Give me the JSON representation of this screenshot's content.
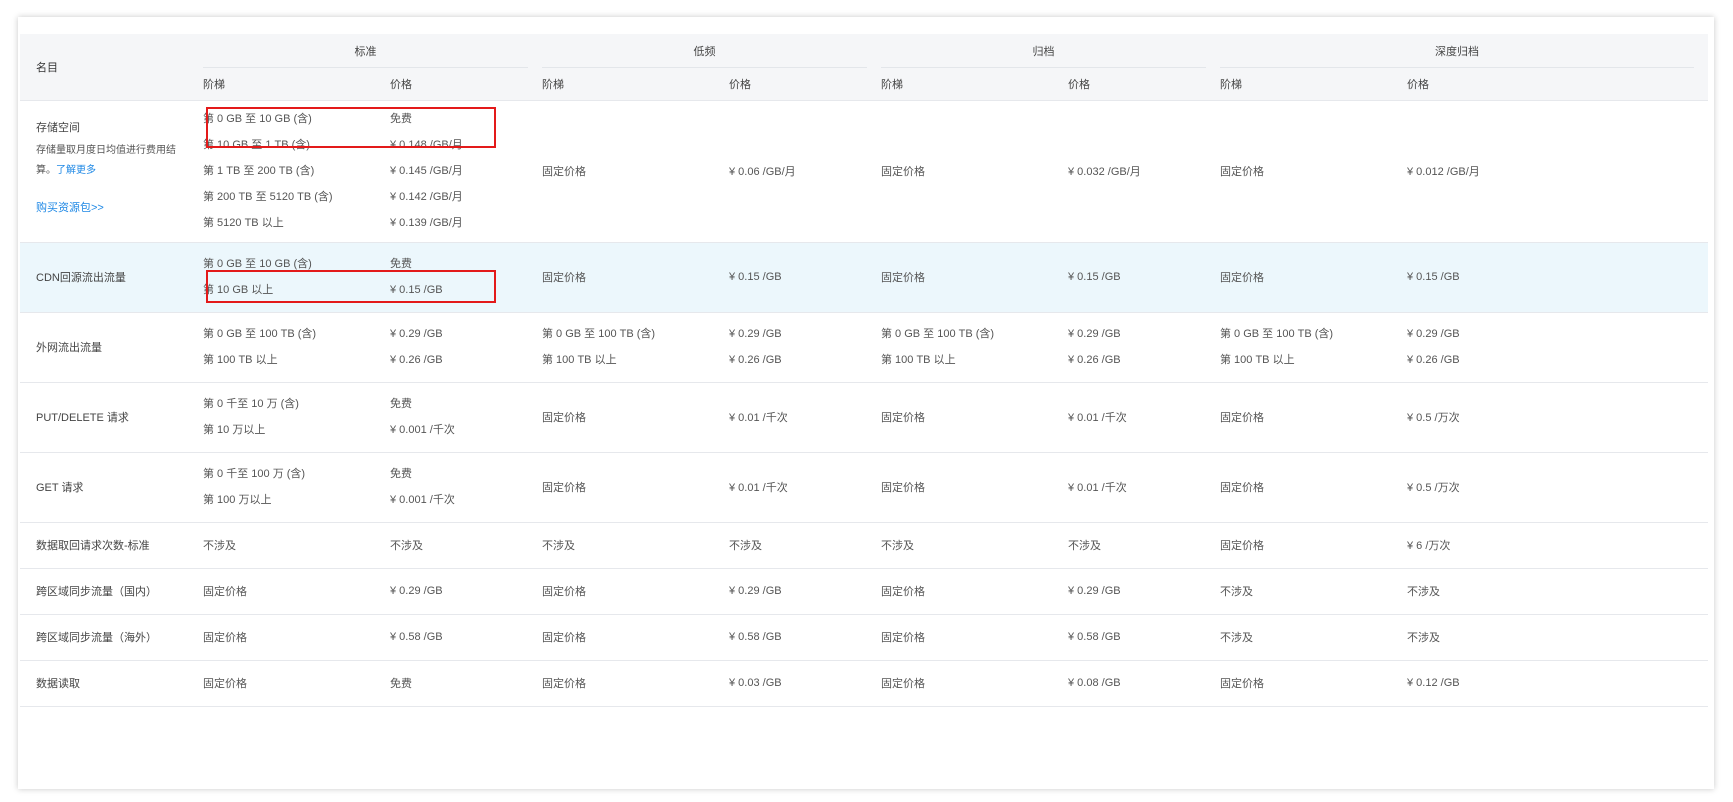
{
  "header": {
    "name_label": "名目",
    "groups": [
      "标准",
      "低频",
      "归档",
      "深度归档"
    ],
    "tier_label": "阶梯",
    "price_label": "价格"
  },
  "rows": {
    "storage": {
      "name": "存储空间",
      "note": "存储量取月度日均值进行费用结算。",
      "note_link": "了解更多",
      "buy_link": "购买资源包>>",
      "std_tiers": [
        "第 0 GB 至 10 GB (含)",
        "第 10 GB 至 1 TB (含)",
        "第 1 TB 至 200 TB (含)",
        "第 200 TB 至 5120 TB (含)",
        "第 5120 TB 以上"
      ],
      "std_prices": [
        "免费",
        "¥ 0.148 /GB/月",
        "¥ 0.145 /GB/月",
        "¥ 0.142 /GB/月",
        "¥ 0.139 /GB/月"
      ],
      "low_tier": "固定价格",
      "low_price": "¥ 0.06 /GB/月",
      "arc_tier": "固定价格",
      "arc_price": "¥ 0.032 /GB/月",
      "deep_tier": "固定价格",
      "deep_price": "¥ 0.012 /GB/月"
    },
    "cdn": {
      "name": "CDN回源流出流量",
      "std_tiers": [
        "第 0 GB 至 10 GB (含)",
        "第 10 GB 以上"
      ],
      "std_prices": [
        "免费",
        "¥ 0.15 /GB"
      ],
      "low_tier": "固定价格",
      "low_price": "¥ 0.15 /GB",
      "arc_tier": "固定价格",
      "arc_price": "¥ 0.15 /GB",
      "deep_tier": "固定价格",
      "deep_price": "¥ 0.15 /GB"
    },
    "internet": {
      "name": "外网流出流量",
      "tiers": [
        "第 0 GB 至 100 TB (含)",
        "第 100 TB 以上"
      ],
      "prices": [
        "¥ 0.29 /GB",
        "¥ 0.26 /GB"
      ]
    },
    "put": {
      "name": "PUT/DELETE 请求",
      "std_tiers": [
        "第 0 千至 10 万 (含)",
        "第 10 万以上"
      ],
      "std_prices": [
        "免费",
        "¥ 0.001 /千次"
      ],
      "low_tier": "固定价格",
      "low_price": "¥ 0.01 /千次",
      "arc_tier": "固定价格",
      "arc_price": "¥ 0.01 /千次",
      "deep_tier": "固定价格",
      "deep_price": "¥ 0.5 /万次"
    },
    "get": {
      "name": "GET 请求",
      "std_tiers": [
        "第 0 千至 100 万 (含)",
        "第 100 万以上"
      ],
      "std_prices": [
        "免费",
        "¥ 0.001 /千次"
      ],
      "low_tier": "固定价格",
      "low_price": "¥ 0.01 /千次",
      "arc_tier": "固定价格",
      "arc_price": "¥ 0.01 /千次",
      "deep_tier": "固定价格",
      "deep_price": "¥ 0.5 /万次"
    },
    "retrieval": {
      "name": "数据取回请求次数-标准",
      "cells": [
        "不涉及",
        "不涉及",
        "不涉及",
        "不涉及",
        "不涉及",
        "不涉及",
        "固定价格",
        "¥ 6 /万次"
      ]
    },
    "crd": {
      "name": "跨区域同步流量（国内）",
      "cells": [
        "固定价格",
        "¥ 0.29 /GB",
        "固定价格",
        "¥ 0.29 /GB",
        "固定价格",
        "¥ 0.29 /GB",
        "不涉及",
        "不涉及"
      ]
    },
    "cro": {
      "name": "跨区域同步流量（海外）",
      "cells": [
        "固定价格",
        "¥ 0.58 /GB",
        "固定价格",
        "¥ 0.58 /GB",
        "固定价格",
        "¥ 0.58 /GB",
        "不涉及",
        "不涉及"
      ]
    },
    "read": {
      "name": "数据读取",
      "cells": [
        "固定价格",
        "免费",
        "固定价格",
        "¥ 0.03 /GB",
        "固定价格",
        "¥ 0.08 /GB",
        "固定价格",
        "¥ 0.12 /GB"
      ]
    }
  }
}
